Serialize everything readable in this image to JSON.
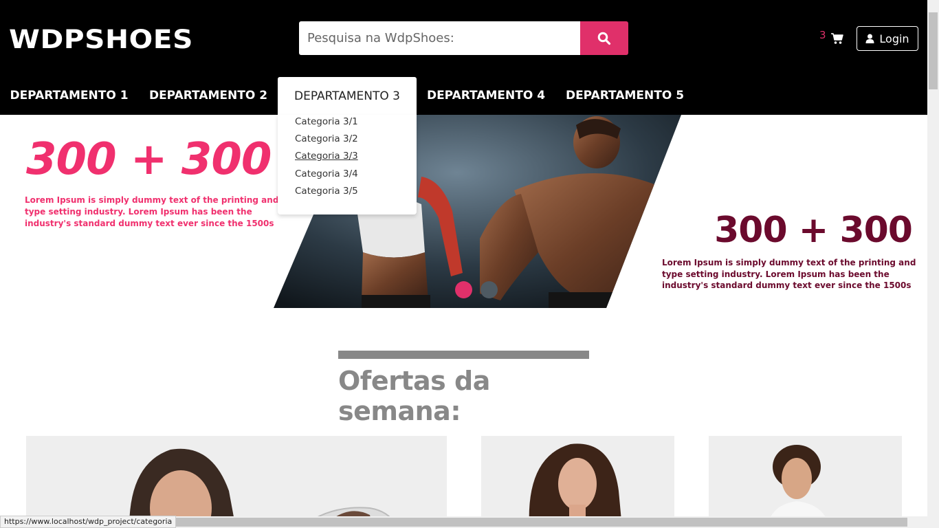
{
  "header": {
    "logo": "WDPSHOES",
    "search_placeholder": "Pesquisa na WdpShoes:",
    "search_icon": "search-icon",
    "cart_count": "3",
    "cart_icon": "shopping-cart-icon",
    "login_label": "Login",
    "login_icon": "user-icon",
    "accent_color": "#e0306a"
  },
  "nav": {
    "items": [
      {
        "label": "DEPARTAMENTO 1"
      },
      {
        "label": "DEPARTAMENTO 2"
      },
      {
        "label": "DEPARTAMENTO 3"
      },
      {
        "label": "DEPARTAMENTO 4"
      },
      {
        "label": "DEPARTAMENTO 5"
      }
    ],
    "dropdown": [
      "Categoria 3/1",
      "Categoria 3/2",
      "Categoria 3/3",
      "Categoria 3/4",
      "Categoria 3/5"
    ]
  },
  "banner": {
    "left_headline": "300 + 300",
    "left_text": "Lorem Ipsum is simply dummy text of the printing and type setting industry. Lorem Ipsum has been the industry's standard dummy text ever since the 1500s",
    "right_headline": "300 + 300",
    "right_text": "Lorem Ipsum is simply dummy text of the printing and type setting industry. Lorem Ipsum has been the industry's standard dummy text ever since the 1500s",
    "left_color": "#f0306e",
    "right_color": "#6b0a2d"
  },
  "offers": {
    "title": "Ofertas da semana:"
  },
  "status_url": "https://www.localhost/wdp_project/categoria"
}
